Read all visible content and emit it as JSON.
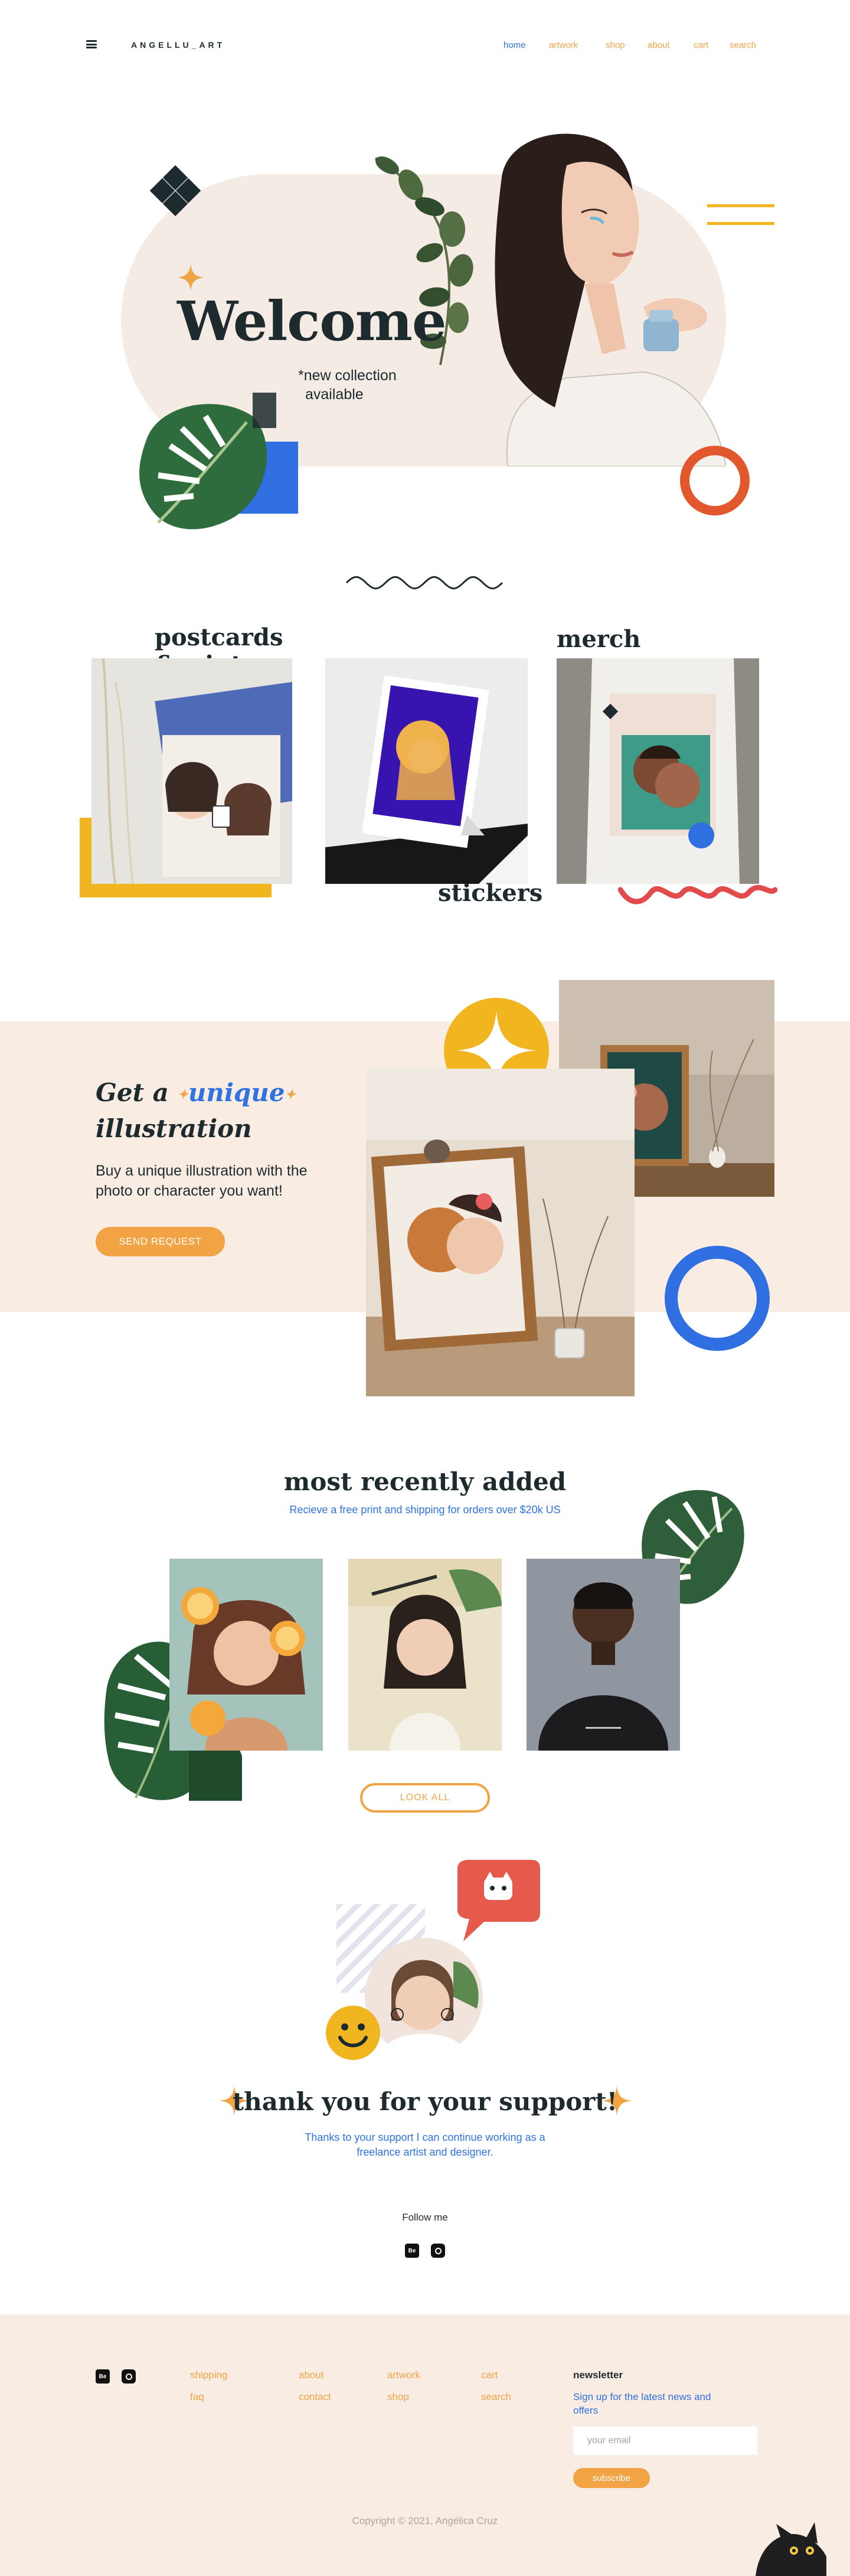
{
  "header": {
    "logo": "ANGELLU_ART",
    "nav": [
      {
        "label": "home",
        "active": true
      },
      {
        "label": "artwork"
      },
      {
        "label": "shop"
      },
      {
        "label": "about"
      },
      {
        "label": "cart"
      },
      {
        "label": "search"
      }
    ]
  },
  "hero": {
    "title": "Welcome",
    "subtitle_line1": "*new collection",
    "subtitle_line2": "available"
  },
  "categories": {
    "postcards_line1": "postcards",
    "postcards_line2": "&prints",
    "merch": "merch",
    "stickers": "stickers"
  },
  "illustration": {
    "title_prefix": "Get a",
    "title_highlight": "unique",
    "title_suffix": "illustration",
    "description": "Buy a unique illustration with the photo or character you want!",
    "button": "SEND REQUEST"
  },
  "recent": {
    "title": "most recently added",
    "subtitle": "Recieve a free print and shipping for orders over $20k US",
    "button": "LOOK ALL"
  },
  "support": {
    "title": "thank you for your support!",
    "subtitle": "Thanks to your support I can continue working as a freelance artist and designer.",
    "follow": "Follow me",
    "social": [
      "Be",
      "instagram"
    ]
  },
  "footer": {
    "col1": [
      "shipping",
      "faq"
    ],
    "col2": [
      "about",
      "contact"
    ],
    "col3": [
      "artwork",
      "shop"
    ],
    "col4": [
      "cart",
      "search"
    ],
    "newsletter_title": "newsletter",
    "newsletter_desc": "Sign up for the latest news and offers",
    "email_placeholder": "your email",
    "subscribe": "subscribe",
    "copyright": "Copyright © 2021, Angélica Cruz"
  },
  "colors": {
    "dark": "#1d2b2e",
    "orange": "#f2a445",
    "blue": "#2f72e0",
    "yellow": "#f1b51f",
    "red": "#e3572c",
    "cream": "#f9ece3"
  }
}
